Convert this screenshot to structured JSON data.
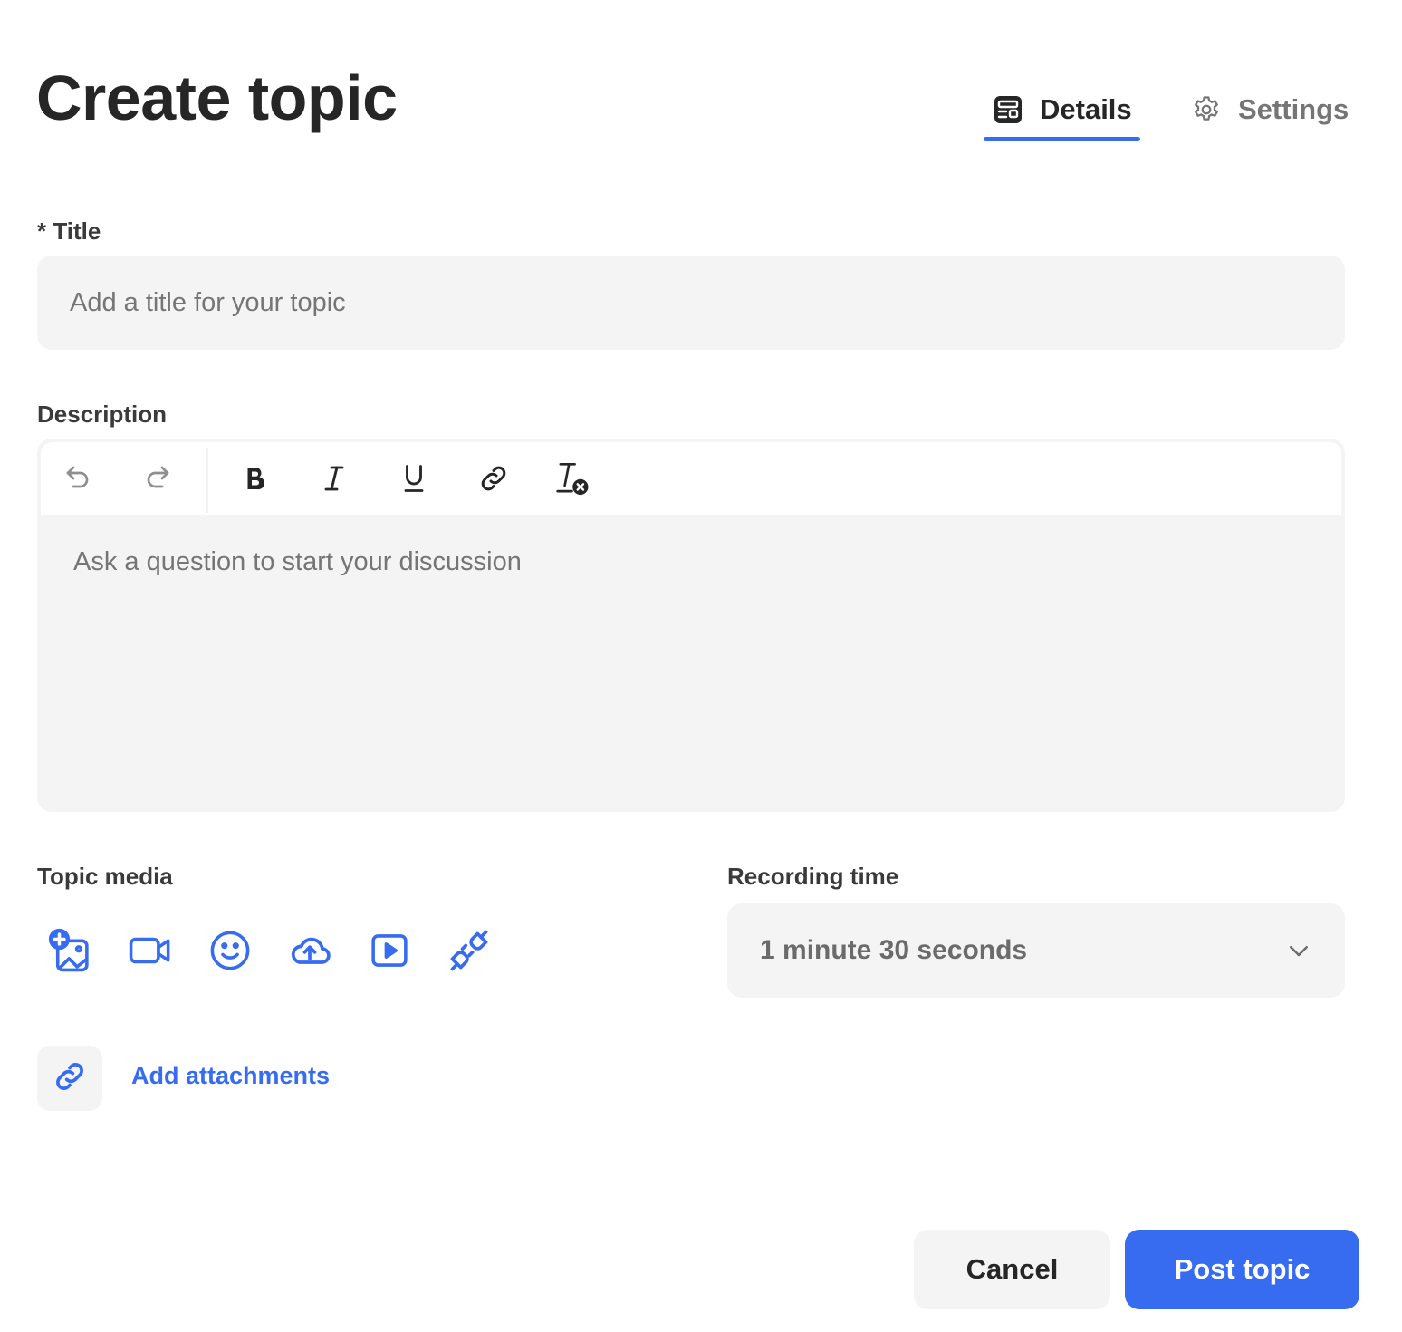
{
  "page": {
    "title": "Create topic"
  },
  "tabs": [
    {
      "label": "Details",
      "icon": "details-icon",
      "active": true
    },
    {
      "label": "Settings",
      "icon": "gear-icon",
      "active": false
    }
  ],
  "form": {
    "title": {
      "label": "* Title",
      "placeholder": "Add a title for your topic",
      "value": ""
    },
    "description": {
      "label": "Description",
      "placeholder": "Ask a question to start your discussion",
      "toolbar": [
        "undo-icon",
        "redo-icon",
        "bold-icon",
        "italic-icon",
        "underline-icon",
        "link-icon",
        "clear-format-icon"
      ]
    },
    "topic_media": {
      "label": "Topic media",
      "buttons": [
        "add-image-icon",
        "video-camera-icon",
        "emoji-icon",
        "cloud-upload-icon",
        "play-video-icon",
        "plug-integration-icon"
      ]
    },
    "recording_time": {
      "label": "Recording time",
      "value": "1 minute 30 seconds"
    },
    "attachments": {
      "label": "Add attachments"
    }
  },
  "actions": {
    "cancel_label": "Cancel",
    "post_label": "Post topic"
  },
  "colors": {
    "accent": "#376cf1",
    "field_bg": "#f4f4f4",
    "text": "#262626",
    "muted": "#757575"
  }
}
